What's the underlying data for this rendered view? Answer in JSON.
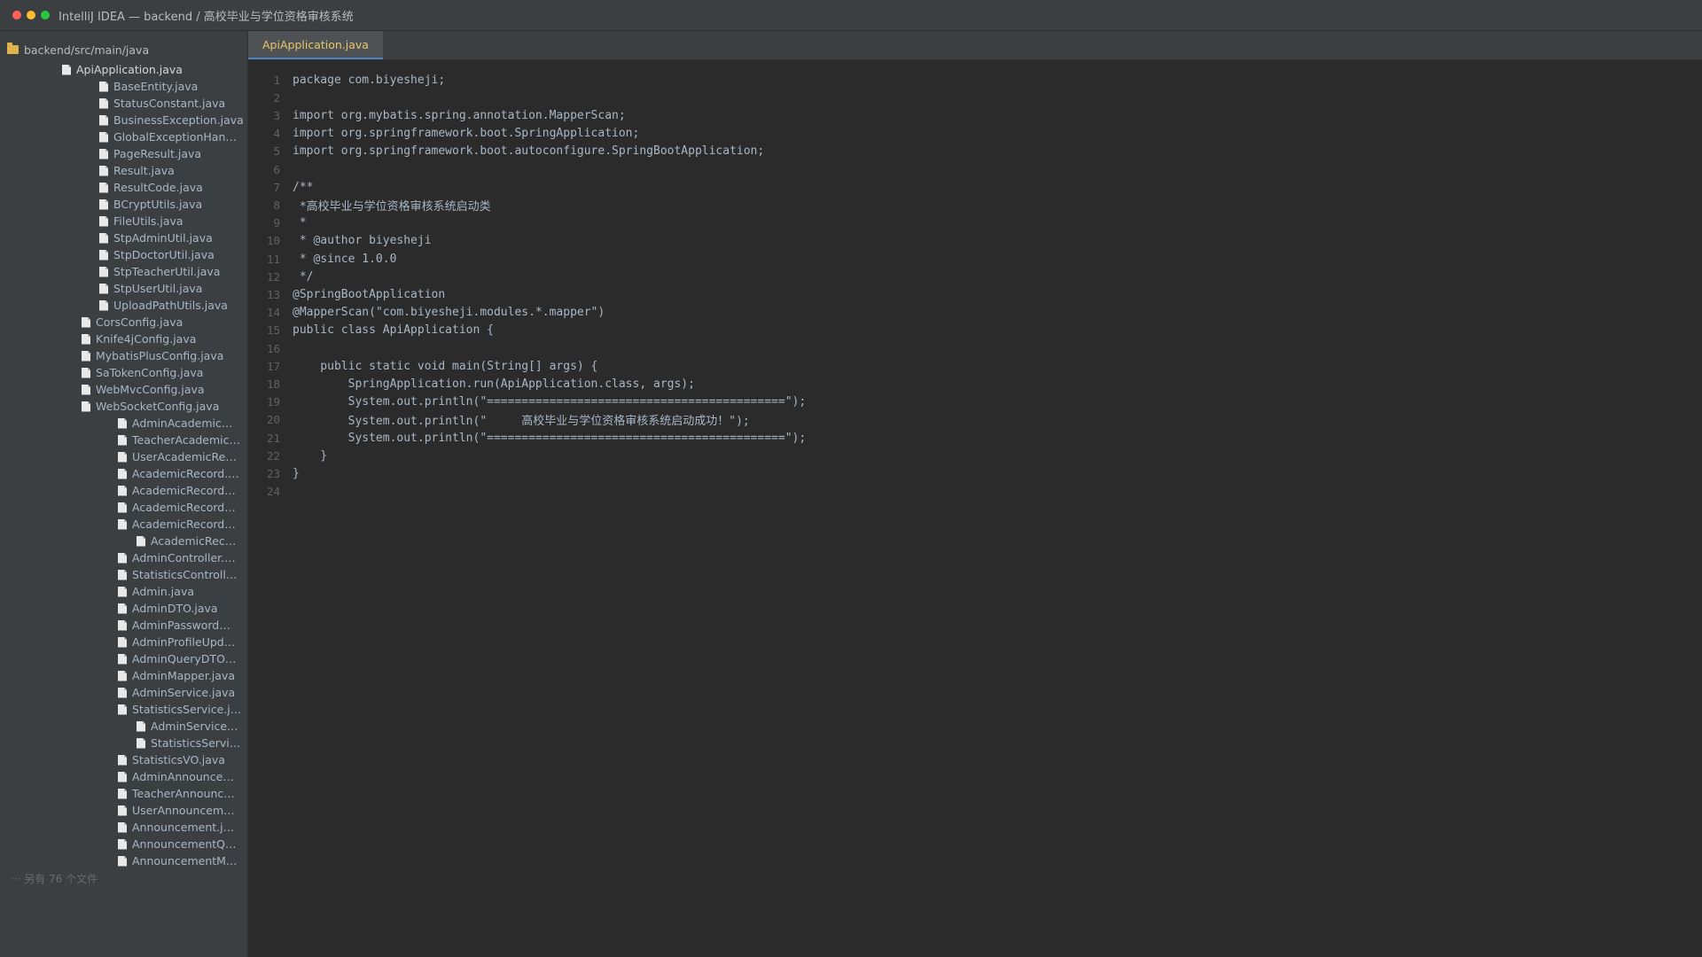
{
  "window": {
    "title": "IntelliJ IDEA — backend / 高校毕业与学位资格审核系统"
  },
  "sidebar": {
    "root_label": "backend/src/main/java",
    "items": [
      {
        "label": "ApiApplication.java",
        "level": 1
      },
      {
        "label": "BaseEntity.java",
        "level": 2
      },
      {
        "label": "StatusConstant.java",
        "level": 2
      },
      {
        "label": "BusinessException.java",
        "level": 2
      },
      {
        "label": "GlobalExceptionHan…",
        "level": 2
      },
      {
        "label": "PageResult.java",
        "level": 2
      },
      {
        "label": "Result.java",
        "level": 2
      },
      {
        "label": "ResultCode.java",
        "level": 2
      },
      {
        "label": "BCryptUtils.java",
        "level": 2
      },
      {
        "label": "FileUtils.java",
        "level": 2
      },
      {
        "label": "StpAdminUtil.java",
        "level": 2
      },
      {
        "label": "StpDoctorUtil.java",
        "level": 2
      },
      {
        "label": "StpTeacherUtil.java",
        "level": 2
      },
      {
        "label": "StpUserUtil.java",
        "level": 2
      },
      {
        "label": "UploadPathUtils.java",
        "level": 2
      },
      {
        "label": "CorsConfig.java",
        "level": 1.5
      },
      {
        "label": "Knife4jConfig.java",
        "level": 1.5
      },
      {
        "label": "MybatisPlusConfig.java",
        "level": 1.5
      },
      {
        "label": "SaTokenConfig.java",
        "level": 1.5
      },
      {
        "label": "WebMvcConfig.java",
        "level": 1.5
      },
      {
        "label": "WebSocketConfig.java",
        "level": 1.5
      },
      {
        "label": "AdminAcademic…",
        "level": 3
      },
      {
        "label": "TeacherAcademic…",
        "level": 3
      },
      {
        "label": "UserAcademicRe…",
        "level": 3
      },
      {
        "label": "AcademicRecord.…",
        "level": 3
      },
      {
        "label": "AcademicRecord…",
        "level": 3
      },
      {
        "label": "AcademicRecord…",
        "level": 3
      },
      {
        "label": "AcademicRecord…",
        "level": 3
      },
      {
        "label": "AcademicRec…",
        "level": 4
      },
      {
        "label": "AdminController.…",
        "level": 3
      },
      {
        "label": "StatisticsControll…",
        "level": 3
      },
      {
        "label": "Admin.java",
        "level": 3
      },
      {
        "label": "AdminDTO.java",
        "level": 3
      },
      {
        "label": "AdminPassword…",
        "level": 3
      },
      {
        "label": "AdminProfileUpd…",
        "level": 3
      },
      {
        "label": "AdminQueryDTO…",
        "level": 3
      },
      {
        "label": "AdminMapper.java",
        "level": 3
      },
      {
        "label": "AdminService.java",
        "level": 3
      },
      {
        "label": "StatisticsService.j…",
        "level": 3
      },
      {
        "label": "AdminService…",
        "level": 4
      },
      {
        "label": "StatisticsServi…",
        "level": 4
      },
      {
        "label": "StatisticsVO.java",
        "level": 3
      },
      {
        "label": "AdminAnnounce…",
        "level": 3
      },
      {
        "label": "TeacherAnnounc…",
        "level": 3
      },
      {
        "label": "UserAnnouncem…",
        "level": 3
      },
      {
        "label": "Announcement.j…",
        "level": 3
      },
      {
        "label": "AnnouncementQ…",
        "level": 3
      },
      {
        "label": "AnnouncementM…",
        "level": 3
      }
    ],
    "more_files": "··· 另有 76 个文件"
  },
  "editor": {
    "active_tab": "ApiApplication.java",
    "lines": [
      "package com.biyesheji;",
      "",
      "import org.mybatis.spring.annotation.MapperScan;",
      "import org.springframework.boot.SpringApplication;",
      "import org.springframework.boot.autoconfigure.SpringBootApplication;",
      "",
      "/**",
      " *高校毕业与学位资格审核系统启动类",
      " *",
      " * @author biyesheji",
      " * @since 1.0.0",
      " */",
      "@SpringBootApplication",
      "@MapperScan(\"com.biyesheji.modules.*.mapper\")",
      "public class ApiApplication {",
      "",
      "    public static void main(String[] args) {",
      "        SpringApplication.run(ApiApplication.class, args);",
      "        System.out.println(\"===========================================\");",
      "        System.out.println(\"     高校毕业与学位资格审核系统启动成功！\");",
      "        System.out.println(\"===========================================\");",
      "    }",
      "}",
      ""
    ]
  },
  "colors": {
    "background": "#2b2b2b",
    "panel": "#3c3f41",
    "code_text": "#a9b7c6",
    "line_number": "#606366",
    "active_tab_text": "#e9c46a"
  },
  "icons": {
    "folder": "folder-icon",
    "file": "java-file-icon"
  }
}
